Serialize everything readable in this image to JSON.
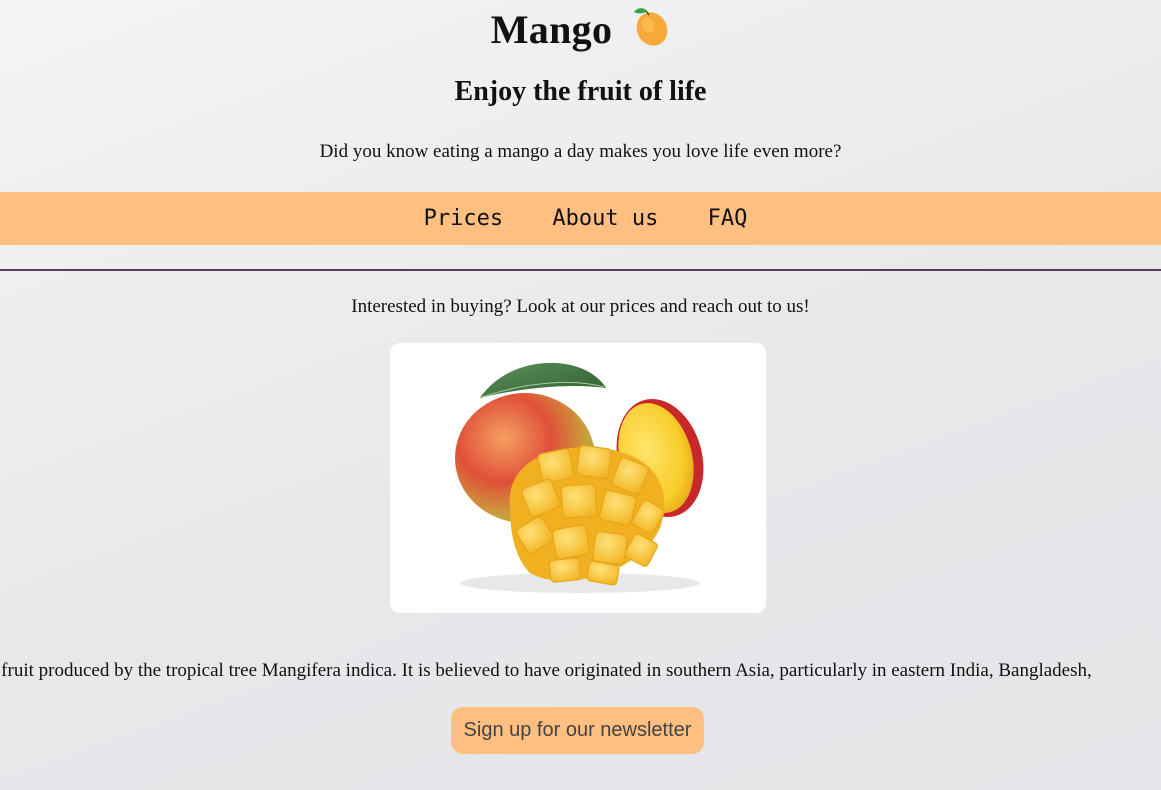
{
  "header": {
    "title": "Mango",
    "title_icon": "mango-emoji-icon",
    "subtitle": "Enjoy the fruit of life",
    "tagline": "Did you know eating a mango a day makes you love life even more?"
  },
  "nav": {
    "items": [
      {
        "label": "Prices"
      },
      {
        "label": "About us"
      },
      {
        "label": "FAQ"
      }
    ]
  },
  "main": {
    "interest_text": "Interested in buying? Look at our prices and reach out to us!",
    "image_subject": "mango-photo",
    "scrolling_text": "e fruit produced by the tropical tree Mangifera indica. It is believed to have originated in southern Asia, particularly in eastern India, Bangladesh,",
    "newsletter_button": "Sign up for our newsletter"
  },
  "colors": {
    "accent": "#ffbf80",
    "divider": "#5a3d5a",
    "background": "#e6e8ea"
  }
}
